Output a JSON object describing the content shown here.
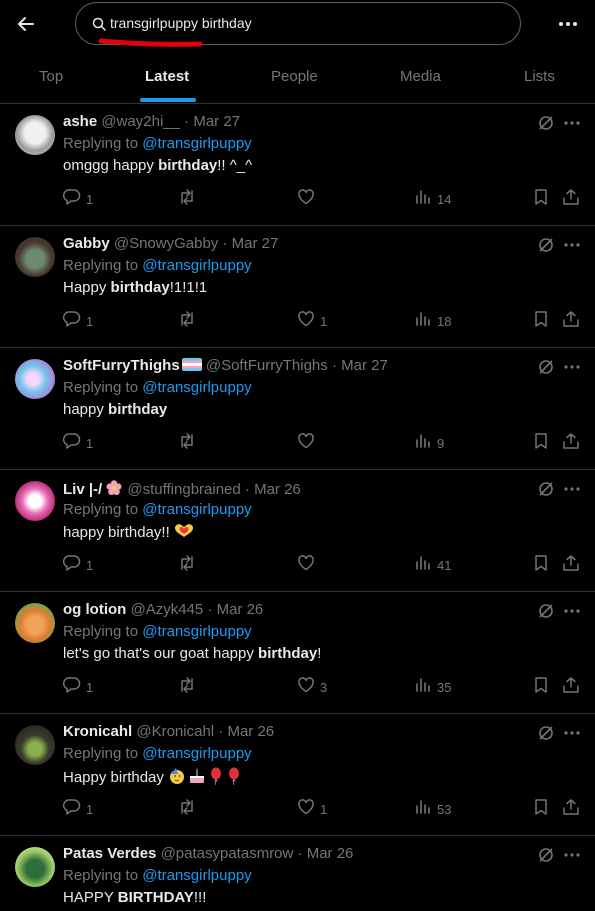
{
  "search": {
    "query": "transgirlpuppy birthday"
  },
  "tabs": [
    {
      "label": "Top"
    },
    {
      "label": "Latest"
    },
    {
      "label": "People"
    },
    {
      "label": "Media"
    },
    {
      "label": "Lists"
    }
  ],
  "colors": {
    "accent": "#1d9bf0",
    "annotation": "#e3000f",
    "muted": "#71767b",
    "background": "#000000"
  },
  "tweets": [
    {
      "name": "ashe",
      "handle": "@way2hi__",
      "date": "Mar 27",
      "replying": "Replying to",
      "mention": "@transgirlpuppy",
      "text_a": "omggg happy ",
      "text_b": "birthday",
      "text_c": "!! ^_^",
      "replies": "1",
      "retweets": "",
      "likes": "",
      "views": "14"
    },
    {
      "name": "Gabby",
      "handle": "@SnowyGabby",
      "date": "Mar 27",
      "replying": "Replying to",
      "mention": "@transgirlpuppy",
      "text_a": "Happy ",
      "text_b": "birthday",
      "text_c": "!1!1!1",
      "replies": "1",
      "retweets": "",
      "likes": "1",
      "views": "18"
    },
    {
      "name": "SoftFurryThighs",
      "handle": "@SoftFurryThighs",
      "date": "Mar 27",
      "replying": "Replying to",
      "mention": "@transgirlpuppy",
      "text_a": "happy ",
      "text_b": "birthday",
      "text_c": "",
      "replies": "1",
      "retweets": "",
      "likes": "",
      "views": "9"
    },
    {
      "name": "Liv |-/",
      "handle": "@stuffingbrained",
      "date": "Mar 26",
      "replying": "Replying to",
      "mention": "@transgirlpuppy",
      "text_a": "happy birthday!! ",
      "text_b": "",
      "text_c": "",
      "replies": "1",
      "retweets": "",
      "likes": "",
      "views": "41"
    },
    {
      "name": "og lotion",
      "handle": "@Azyk445",
      "date": "Mar 26",
      "replying": "Replying to",
      "mention": "@transgirlpuppy",
      "text_a": "let's go that's our goat happy ",
      "text_b": "birthday",
      "text_c": "!",
      "replies": "1",
      "retweets": "",
      "likes": "3",
      "views": "35"
    },
    {
      "name": "Kronicahl",
      "handle": "@Kronicahl",
      "date": "Mar 26",
      "replying": "Replying to",
      "mention": "@transgirlpuppy",
      "text_a": "Happy birthday ",
      "text_b": "",
      "text_c": "",
      "replies": "1",
      "retweets": "",
      "likes": "1",
      "views": "53"
    },
    {
      "name": "Patas Verdes",
      "handle": "@patasypatasmrow",
      "date": "Mar 26",
      "replying": "Replying to",
      "mention": "@transgirlpuppy",
      "text_a": "HAPPY ",
      "text_b": "BIRTHDAY",
      "text_c": "!!!",
      "replies": "",
      "retweets": "",
      "likes": "",
      "views": ""
    }
  ]
}
